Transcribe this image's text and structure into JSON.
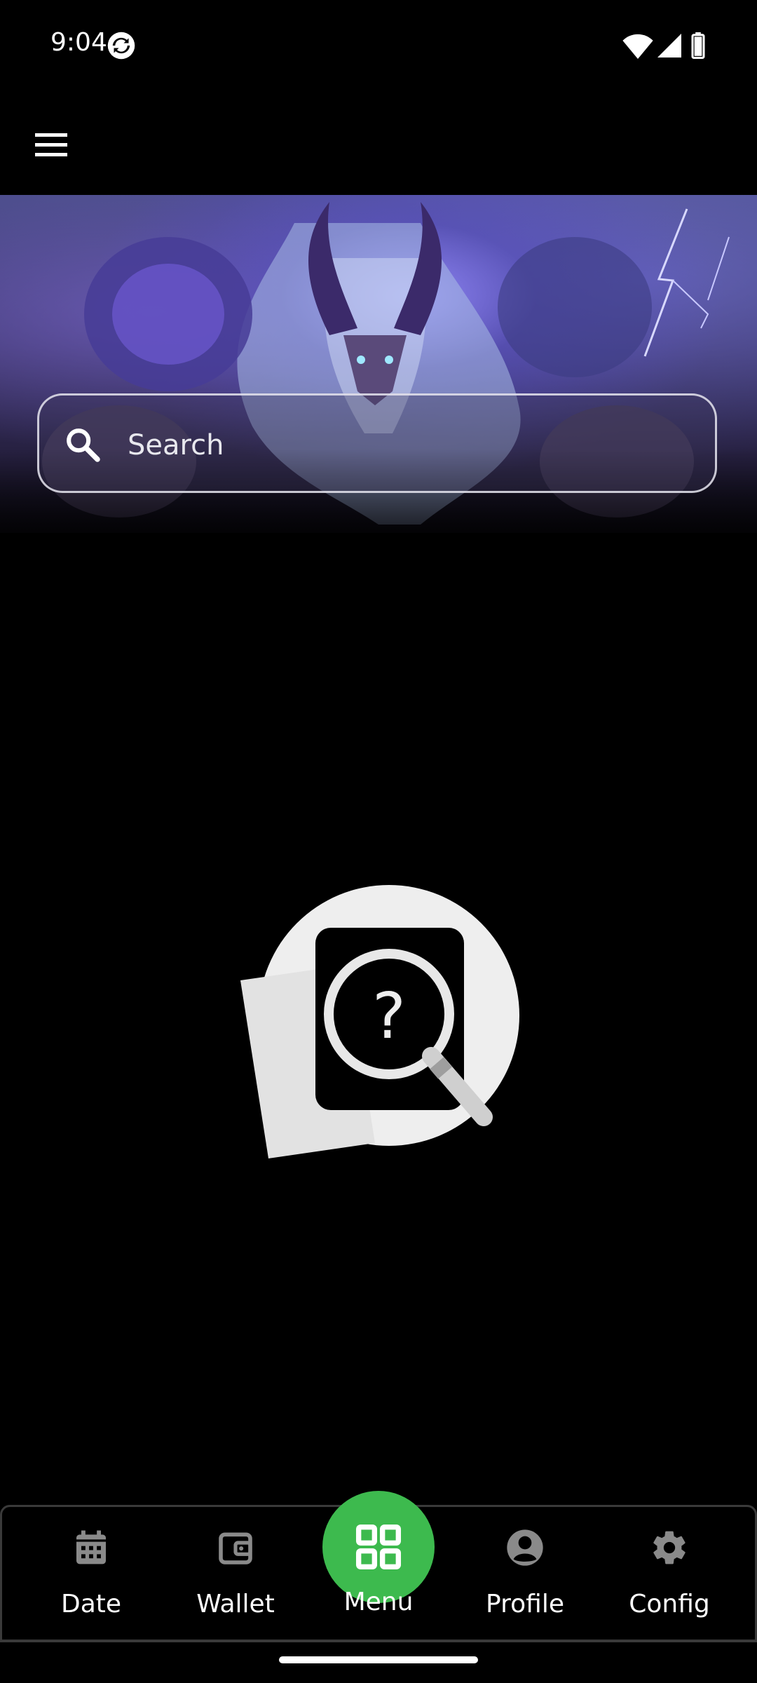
{
  "status_bar": {
    "time": "9:04",
    "icons": [
      "sync-icon",
      "wifi-icon",
      "signal-icon",
      "battery-icon"
    ]
  },
  "app_bar": {
    "menu_icon": "hamburger-menu-icon"
  },
  "banner": {
    "image": "fantasy-demon-hero-artwork"
  },
  "search": {
    "placeholder": "Search",
    "value": "",
    "icon": "search-icon"
  },
  "empty_state": {
    "icon": "no-results-search-illustration"
  },
  "bottom_nav": {
    "items": [
      {
        "label": "Date",
        "icon": "calendar-icon"
      },
      {
        "label": "Wallet",
        "icon": "wallet-icon"
      },
      {
        "label": "Menu",
        "icon": "grid-icon",
        "active": true
      },
      {
        "label": "Profile",
        "icon": "profile-icon"
      },
      {
        "label": "Config",
        "icon": "gear-icon"
      }
    ]
  },
  "colors": {
    "background": "#000000",
    "accent": "#3dba4e",
    "nav_icon": "#8a8a8a",
    "text": "#ffffff"
  }
}
